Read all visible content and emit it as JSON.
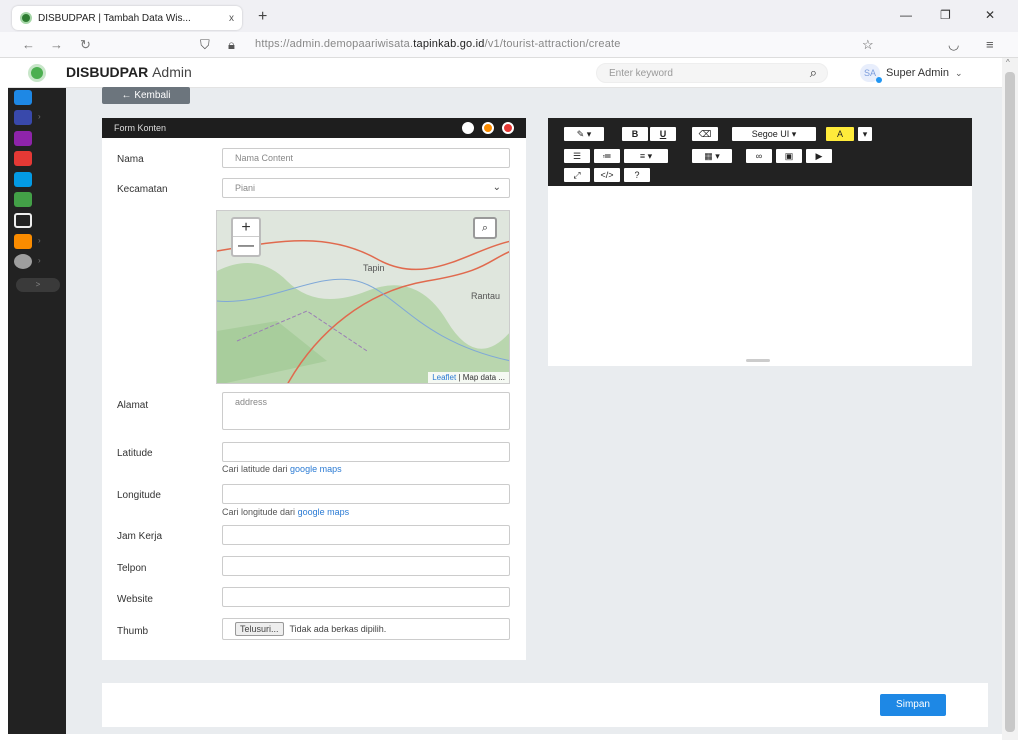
{
  "browser": {
    "tab_title": "DISBUDPAR | Tambah Data Wis...",
    "tab_close": "x",
    "new_tab": "+",
    "url_prefix": "https://admin.demopaariwisata.",
    "url_domain": "tapinkab.go.id",
    "url_path": "/v1/tourist-attraction/create"
  },
  "header": {
    "brand_bold": "DISBUDPAR",
    "brand_light": "Admin",
    "search_placeholder": "Enter keyword",
    "user_initials": "SA",
    "user_name": "Super Admin"
  },
  "sidebar": {
    "items": [
      {
        "icon": "monitor-icon",
        "color": "#1e88e5"
      },
      {
        "icon": "pencil-icon",
        "color": "#3949ab"
      },
      {
        "icon": "building-icon",
        "color": "#8e24aa"
      },
      {
        "icon": "bell-icon",
        "color": "#e53935"
      },
      {
        "icon": "info-icon",
        "color": "#039be5"
      },
      {
        "icon": "book-icon",
        "color": "#43a047"
      },
      {
        "icon": "image-icon",
        "color": "#eeeeee"
      },
      {
        "icon": "folder-icon",
        "color": "#fb8c00"
      },
      {
        "icon": "gear-icon",
        "color": "#9e9e9e"
      }
    ],
    "collapse": ">"
  },
  "back_button": "← Kembali",
  "form": {
    "title": "Form Konten",
    "nama_label": "Nama",
    "nama_placeholder": "Nama Content",
    "kecamatan_label": "Kecamatan",
    "kecamatan_value": "Piani",
    "map_zoom_in": "+",
    "map_zoom_out": "—",
    "map_label_tapin": "Tapin",
    "map_label_rantau": "Rantau",
    "map_attr_leaflet": "Leaflet",
    "map_attr_rest": "| Map data ...",
    "alamat_label": "Alamat",
    "alamat_placeholder": "address",
    "latitude_label": "Latitude",
    "latitude_help": "Cari latitude dari",
    "latitude_link": "google maps",
    "longitude_label": "Longitude",
    "longitude_help": "Cari longitude dari",
    "longitude_link": "google maps",
    "jam_label": "Jam Kerja",
    "telepon_label": "Telpon",
    "website_label": "Website",
    "thumb_label": "Thumb",
    "file_button": "Telusuri...",
    "file_status": "Tidak ada berkas dipilih."
  },
  "editor": {
    "font_name": "Segoe UI",
    "bold": "B",
    "underline": "U"
  },
  "footer": {
    "save_label": "Simpan"
  },
  "colors": {
    "primary": "#1e88e5",
    "dark": "#222222",
    "back_button": "#6c757d"
  }
}
